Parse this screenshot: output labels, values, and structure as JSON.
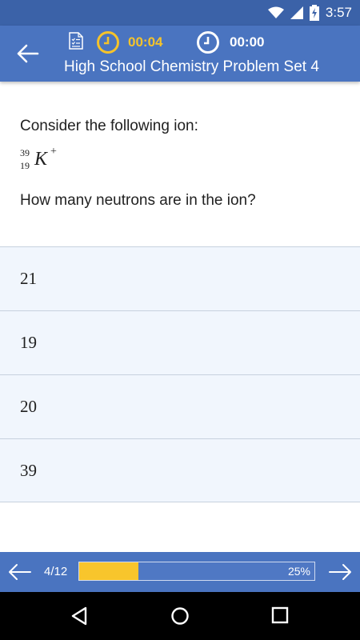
{
  "status_bar": {
    "time": "3:57",
    "icons": [
      "wifi-icon",
      "signal-icon",
      "battery-charging-icon"
    ]
  },
  "header": {
    "back_icon": "arrow-left-icon",
    "doc_icon": "checklist-document-icon",
    "timer_elapsed_question": "00:04",
    "timer_total": "00:00",
    "title": "High School Chemistry Problem Set 4",
    "colors": {
      "bar": "#4a74c0",
      "timer_accent": "#f5c32b"
    }
  },
  "question": {
    "intro": "Consider the following ion:",
    "formula": {
      "mass_number": "39",
      "atomic_number": "19",
      "symbol": "K",
      "charge": "+"
    },
    "prompt": "How many neutrons are in the ion?"
  },
  "answers": [
    {
      "label": "21"
    },
    {
      "label": "19"
    },
    {
      "label": "20"
    },
    {
      "label": "39"
    }
  ],
  "progress": {
    "count": "4/12",
    "percent_label": "25%",
    "fraction": 0.25,
    "prev_icon": "arrow-left-icon",
    "next_icon": "arrow-right-icon",
    "colors": {
      "fill": "#f8c52c"
    }
  },
  "system_nav": {
    "icons": [
      "back-triangle-icon",
      "home-circle-icon",
      "recents-square-icon"
    ]
  }
}
